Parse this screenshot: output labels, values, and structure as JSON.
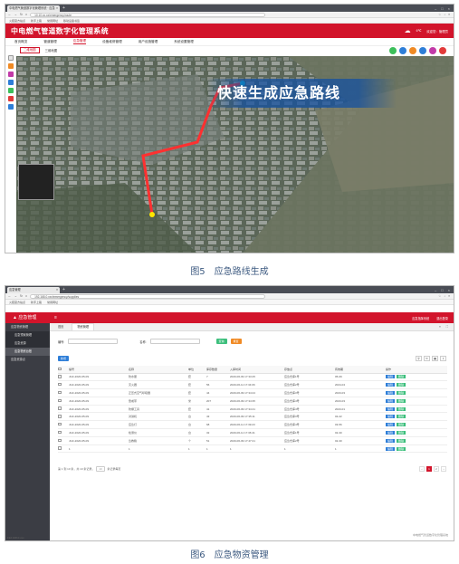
{
  "shot1": {
    "tab_title": "中电燃气管道数字化管理系统 · 应急",
    "url": "10.10.xx.xx/emergency/route",
    "bookmarks": [
      "火狐官方站点",
      "新手上路",
      "常用网址",
      "移动设备书签"
    ],
    "app_title": "中电燃气管道数字化管理系统",
    "temp": "6℃",
    "user": "欢迎您：管理员",
    "nav": [
      "首页概览",
      "管道管理",
      "应急管理",
      "设备维修管理",
      "用户设施管理",
      "系统设置管理"
    ],
    "subtabs": [
      "二维地图",
      "三维地图"
    ],
    "banner": "快速生成应急路线"
  },
  "caption1": "图5　应急路线生成",
  "shot2": {
    "tab_title": "应急管理",
    "url": "192.168.0.xxx/emergency/supplies",
    "bookmarks": [
      "火狐官方站点",
      "新手上路",
      "常用网址"
    ],
    "logo": "应急管理",
    "header_links": [
      "应急指挥系统",
      "退出登录"
    ],
    "sidebar": [
      "应急物资管理",
      "应急预案管理",
      "应急资源",
      "应急物资台账",
      "应急资源点"
    ],
    "tabs": [
      "首页",
      "物资管理"
    ],
    "search_label1": "编号:",
    "search_label2": "名称:",
    "btn_search": "查询",
    "btn_reset": "重置",
    "btn_add": "新增",
    "columns": [
      "",
      "编号",
      "名称",
      "单位",
      "库存数量",
      "入库时间",
      "存放点",
      "有效期",
      "操作"
    ],
    "rows": [
      [
        "",
        "JGF-2020-05-09",
        "防水服",
        "套",
        "7",
        "2020-06-09 17:33:25",
        "应急仓库1号",
        "05-09",
        "编辑",
        "删除"
      ],
      [
        "",
        "JGF-2020-05-09",
        "灭火器",
        "套",
        "56",
        "2020-06-11 17:34:06",
        "应急仓库2号",
        "2024-04",
        "编辑",
        "删除"
      ],
      [
        "",
        "JGF-2020-05-09",
        "正压式空气呼吸器",
        "套",
        "44",
        "2020-06-09 17:34:24",
        "应急仓库3号",
        "2023-03",
        "编辑",
        "删除"
      ],
      [
        "",
        "JGF-2020-05-09",
        "警戒带",
        "米",
        "207",
        "2020-06-09 17:34:35",
        "应急仓库4号",
        "2023-03",
        "编辑",
        "删除"
      ],
      [
        "",
        "JGF-2020-05-09",
        "防爆工具",
        "套",
        "41",
        "2020-06-09 17:34:41",
        "应急仓库4号",
        "2023-01",
        "编辑",
        "删除"
      ],
      [
        "",
        "JGF-2020-05-09",
        "对讲机",
        "台",
        "43",
        "2020-06-09 17:35:11",
        "应急仓库3号",
        "02-22",
        "编辑",
        "删除"
      ],
      [
        "",
        "JGF-2020-05-09",
        "应急灯",
        "台",
        "68",
        "2020-06-11 17:39:23",
        "应急仓库4号",
        "03-56",
        "编辑",
        "删除"
      ],
      [
        "",
        "JGF-2020-05-09",
        "检测仪",
        "台",
        "32",
        "2020-06-11 17:36:41",
        "应急仓库1号",
        "02-30",
        "编辑",
        "删除"
      ],
      [
        "",
        "JGF-2020-05-09",
        "急救箱",
        "个",
        "51",
        "2020-06-09 17:47:21",
        "应急仓库2号",
        "02-30",
        "编辑",
        "删除"
      ],
      [
        "",
        "1",
        "1",
        "1",
        "1",
        "1",
        "1",
        "1",
        "编辑",
        "删除"
      ]
    ],
    "pager_text": "第 1 到 10 条，共 10 条记录。",
    "page_size": "10",
    "pager_suffix": "条记录每页",
    "pages": [
      "‹",
      "1",
      "2",
      "›"
    ],
    "footer": "中电燃气管道数字化管理系统",
    "status": "192.168.0.xxx"
  },
  "caption2": "图6　应急物资管理",
  "colors": {
    "brand_red": "#d2142b",
    "sidebar": "#3b3d44",
    "edit": "#2e7ed8",
    "delete": "#3cbf7c"
  },
  "tool_icons": [
    "search-icon",
    "refresh-icon",
    "grid-icon",
    "export-icon"
  ]
}
